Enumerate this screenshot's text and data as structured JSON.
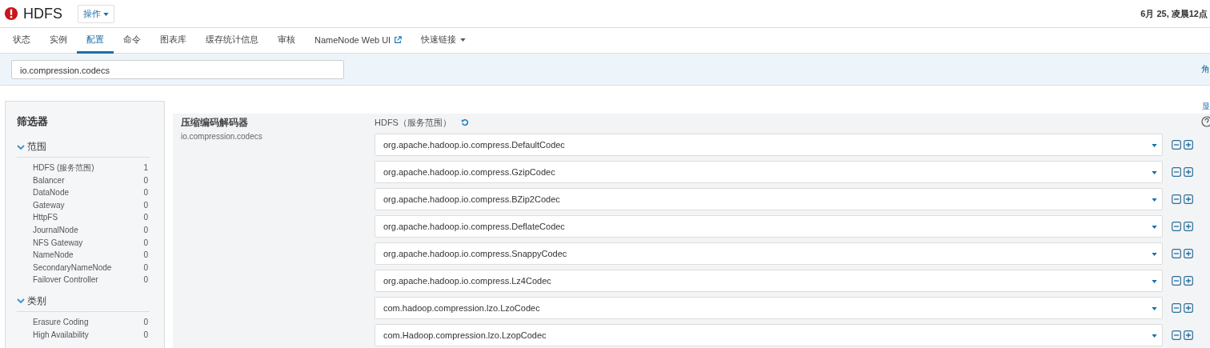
{
  "header": {
    "title": "HDFS",
    "actions_button": "操作",
    "timestamp": "6月 25, 凌晨12点"
  },
  "tabs": [
    {
      "label": "状态",
      "selected": false,
      "kind": "plain"
    },
    {
      "label": "实例",
      "selected": false,
      "kind": "plain"
    },
    {
      "label": "配置",
      "selected": true,
      "kind": "plain"
    },
    {
      "label": "命令",
      "selected": false,
      "kind": "plain"
    },
    {
      "label": "图表库",
      "selected": false,
      "kind": "plain"
    },
    {
      "label": "缓存统计信息",
      "selected": false,
      "kind": "plain"
    },
    {
      "label": "审核",
      "selected": false,
      "kind": "plain"
    },
    {
      "label": "NameNode Web UI",
      "selected": false,
      "kind": "external"
    },
    {
      "label": "快速链接",
      "selected": false,
      "kind": "dropdown"
    }
  ],
  "search": {
    "value": "io.compression.codecs",
    "right_link": "角"
  },
  "show_link": "显",
  "filters": {
    "title": "筛选器",
    "groups": [
      {
        "label": "范围",
        "expanded": true,
        "items": [
          {
            "label": "HDFS (服务范围)",
            "count": "1"
          },
          {
            "label": "Balancer",
            "count": "0"
          },
          {
            "label": "DataNode",
            "count": "0"
          },
          {
            "label": "Gateway",
            "count": "0"
          },
          {
            "label": "HttpFS",
            "count": "0"
          },
          {
            "label": "JournalNode",
            "count": "0"
          },
          {
            "label": "NFS Gateway",
            "count": "0"
          },
          {
            "label": "NameNode",
            "count": "0"
          },
          {
            "label": "SecondaryNameNode",
            "count": "0"
          },
          {
            "label": "Failover Controller",
            "count": "0"
          }
        ]
      },
      {
        "label": "类别",
        "expanded": true,
        "items": [
          {
            "label": "Erasure Coding",
            "count": "0"
          },
          {
            "label": "High Availability",
            "count": "0"
          }
        ]
      }
    ]
  },
  "property": {
    "name": "压缩编码解码器",
    "key": "io.compression.codecs",
    "scope": "HDFS（服务范围）",
    "values": [
      "org.apache.hadoop.io.compress.DefaultCodec",
      "org.apache.hadoop.io.compress.GzipCodec",
      "org.apache.hadoop.io.compress.BZip2Codec",
      "org.apache.hadoop.io.compress.DeflateCodec",
      "org.apache.hadoop.io.compress.SnappyCodec",
      "org.apache.hadoop.io.compress.Lz4Codec",
      "com.hadoop.compression.lzo.LzoCodec",
      "com.Hadoop.compression.lzo.LzopCodec"
    ]
  }
}
